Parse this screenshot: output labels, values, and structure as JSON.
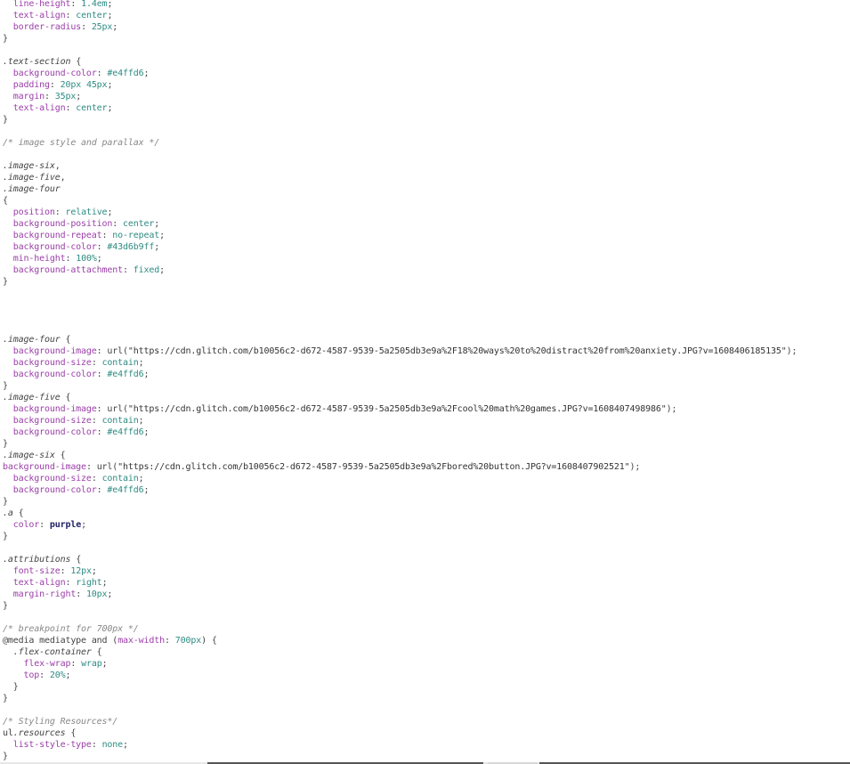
{
  "editor": {
    "language": "css",
    "lines": [
      {
        "t": [
          [
            "prop",
            "  line-height"
          ],
          [
            "punct",
            ": "
          ],
          [
            "num",
            "1.4em"
          ],
          [
            "punct",
            ";"
          ]
        ]
      },
      {
        "t": [
          [
            "prop",
            "  text-align"
          ],
          [
            "punct",
            ": "
          ],
          [
            "val",
            "center"
          ],
          [
            "punct",
            ";"
          ]
        ]
      },
      {
        "t": [
          [
            "prop",
            "  border-radius"
          ],
          [
            "punct",
            ": "
          ],
          [
            "num",
            "25px"
          ],
          [
            "punct",
            ";"
          ]
        ]
      },
      {
        "t": [
          [
            "punct",
            "}"
          ]
        ]
      },
      {
        "t": []
      },
      {
        "t": [
          [
            "selector",
            ".text-section"
          ],
          [
            "punct",
            " {"
          ]
        ]
      },
      {
        "t": [
          [
            "prop",
            "  background-color"
          ],
          [
            "punct",
            ": "
          ],
          [
            "color",
            "#e4ffd6"
          ],
          [
            "punct",
            ";"
          ]
        ]
      },
      {
        "t": [
          [
            "prop",
            "  padding"
          ],
          [
            "punct",
            ": "
          ],
          [
            "num",
            "20px 45px"
          ],
          [
            "punct",
            ";"
          ]
        ]
      },
      {
        "t": [
          [
            "prop",
            "  margin"
          ],
          [
            "punct",
            ": "
          ],
          [
            "num",
            "35px"
          ],
          [
            "punct",
            ";"
          ]
        ]
      },
      {
        "t": [
          [
            "prop",
            "  text-align"
          ],
          [
            "punct",
            ": "
          ],
          [
            "val",
            "center"
          ],
          [
            "punct",
            ";"
          ]
        ]
      },
      {
        "t": [
          [
            "punct",
            "}"
          ]
        ]
      },
      {
        "t": []
      },
      {
        "t": [
          [
            "comment",
            "/* image style and parallax */"
          ]
        ]
      },
      {
        "t": []
      },
      {
        "t": [
          [
            "selector",
            ".image-six"
          ],
          [
            "punct",
            ","
          ]
        ]
      },
      {
        "t": [
          [
            "selector",
            ".image-five"
          ],
          [
            "punct",
            ","
          ]
        ]
      },
      {
        "t": [
          [
            "selector",
            ".image-four"
          ]
        ]
      },
      {
        "t": [
          [
            "punct",
            "{"
          ]
        ]
      },
      {
        "t": [
          [
            "prop",
            "  position"
          ],
          [
            "punct",
            ": "
          ],
          [
            "val",
            "relative"
          ],
          [
            "punct",
            ";"
          ]
        ]
      },
      {
        "t": [
          [
            "prop",
            "  background-position"
          ],
          [
            "punct",
            ": "
          ],
          [
            "val",
            "center"
          ],
          [
            "punct",
            ";"
          ]
        ]
      },
      {
        "t": [
          [
            "prop",
            "  background-repeat"
          ],
          [
            "punct",
            ": "
          ],
          [
            "val",
            "no-repeat"
          ],
          [
            "punct",
            ";"
          ]
        ]
      },
      {
        "t": [
          [
            "prop",
            "  background-color"
          ],
          [
            "punct",
            ": "
          ],
          [
            "color",
            "#43d6b9ff"
          ],
          [
            "punct",
            ";"
          ]
        ]
      },
      {
        "t": [
          [
            "prop",
            "  min-height"
          ],
          [
            "punct",
            ": "
          ],
          [
            "num",
            "100%"
          ],
          [
            "punct",
            ";"
          ]
        ]
      },
      {
        "t": [
          [
            "prop",
            "  background-attachment"
          ],
          [
            "punct",
            ": "
          ],
          [
            "val",
            "fixed"
          ],
          [
            "punct",
            ";"
          ]
        ]
      },
      {
        "t": [
          [
            "punct",
            "}"
          ]
        ]
      },
      {
        "t": []
      },
      {
        "t": []
      },
      {
        "t": []
      },
      {
        "t": []
      },
      {
        "t": [
          [
            "selector",
            ".image-four"
          ],
          [
            "punct",
            " {"
          ]
        ]
      },
      {
        "t": [
          [
            "prop",
            "  background-image"
          ],
          [
            "punct",
            ": "
          ],
          [
            "fn",
            "url("
          ],
          [
            "str",
            "\"https://cdn.glitch.com/b10056c2-d672-4587-9539-5a2505db3e9a%2F18%20ways%20to%20distract%20from%20anxiety.JPG?v=1608406185135\""
          ],
          [
            "fn",
            ")"
          ],
          [
            "punct",
            ";"
          ]
        ]
      },
      {
        "t": [
          [
            "prop",
            "  background-size"
          ],
          [
            "punct",
            ": "
          ],
          [
            "val",
            "contain"
          ],
          [
            "punct",
            ";"
          ]
        ]
      },
      {
        "t": [
          [
            "prop",
            "  background-color"
          ],
          [
            "punct",
            ": "
          ],
          [
            "color",
            "#e4ffd6"
          ],
          [
            "punct",
            ";"
          ]
        ]
      },
      {
        "t": [
          [
            "punct",
            "}"
          ]
        ]
      },
      {
        "t": [
          [
            "selector",
            ".image-five"
          ],
          [
            "punct",
            " {"
          ]
        ]
      },
      {
        "t": [
          [
            "prop",
            "  background-image"
          ],
          [
            "punct",
            ": "
          ],
          [
            "fn",
            "url("
          ],
          [
            "str",
            "\"https://cdn.glitch.com/b10056c2-d672-4587-9539-5a2505db3e9a%2Fcool%20math%20games.JPG?v=1608407498986\""
          ],
          [
            "fn",
            ")"
          ],
          [
            "punct",
            ";"
          ]
        ]
      },
      {
        "t": [
          [
            "prop",
            "  background-size"
          ],
          [
            "punct",
            ": "
          ],
          [
            "val",
            "contain"
          ],
          [
            "punct",
            ";"
          ]
        ]
      },
      {
        "t": [
          [
            "prop",
            "  background-color"
          ],
          [
            "punct",
            ": "
          ],
          [
            "color",
            "#e4ffd6"
          ],
          [
            "punct",
            ";"
          ]
        ]
      },
      {
        "t": [
          [
            "punct",
            "}"
          ]
        ]
      },
      {
        "t": [
          [
            "selector",
            ".image-six"
          ],
          [
            "punct",
            " {"
          ]
        ]
      },
      {
        "t": [
          [
            "prop",
            "background-image"
          ],
          [
            "punct",
            ": "
          ],
          [
            "fn",
            "url("
          ],
          [
            "str",
            "\"https://cdn.glitch.com/b10056c2-d672-4587-9539-5a2505db3e9a%2Fbored%20button.JPG?v=1608407902521\""
          ],
          [
            "fn",
            ")"
          ],
          [
            "punct",
            ";"
          ]
        ]
      },
      {
        "t": [
          [
            "prop",
            "  background-size"
          ],
          [
            "punct",
            ": "
          ],
          [
            "val",
            "contain"
          ],
          [
            "punct",
            ";"
          ]
        ]
      },
      {
        "t": [
          [
            "prop",
            "  background-color"
          ],
          [
            "punct",
            ": "
          ],
          [
            "color",
            "#e4ffd6"
          ],
          [
            "punct",
            ";"
          ]
        ]
      },
      {
        "t": [
          [
            "punct",
            "}"
          ]
        ]
      },
      {
        "t": [
          [
            "selector",
            ".a"
          ],
          [
            "punct",
            " {"
          ]
        ]
      },
      {
        "t": [
          [
            "prop",
            "  color"
          ],
          [
            "punct",
            ": "
          ],
          [
            "purple",
            "purple"
          ],
          [
            "punct",
            ";"
          ]
        ]
      },
      {
        "t": [
          [
            "punct",
            "}"
          ]
        ]
      },
      {
        "t": []
      },
      {
        "t": [
          [
            "selector",
            ".attributions"
          ],
          [
            "punct",
            " {"
          ]
        ]
      },
      {
        "t": [
          [
            "prop",
            "  font-size"
          ],
          [
            "punct",
            ": "
          ],
          [
            "num",
            "12px"
          ],
          [
            "punct",
            ";"
          ]
        ]
      },
      {
        "t": [
          [
            "prop",
            "  text-align"
          ],
          [
            "punct",
            ": "
          ],
          [
            "val",
            "right"
          ],
          [
            "punct",
            ";"
          ]
        ]
      },
      {
        "t": [
          [
            "prop",
            "  margin-right"
          ],
          [
            "punct",
            ": "
          ],
          [
            "num",
            "10px"
          ],
          [
            "punct",
            ";"
          ]
        ]
      },
      {
        "t": [
          [
            "punct",
            "}"
          ]
        ]
      },
      {
        "t": []
      },
      {
        "t": [
          [
            "comment",
            "/* breakpoint for 700px */"
          ]
        ]
      },
      {
        "t": [
          [
            "keyword",
            "@media mediatype "
          ],
          [
            "keyword",
            "and"
          ],
          [
            "punct",
            " ("
          ],
          [
            "prop",
            "max-width"
          ],
          [
            "punct",
            ": "
          ],
          [
            "num",
            "700px"
          ],
          [
            "punct",
            ") {"
          ]
        ]
      },
      {
        "t": [
          [
            "selector",
            "  .flex-container"
          ],
          [
            "punct",
            " {"
          ]
        ]
      },
      {
        "t": [
          [
            "prop",
            "    flex-wrap"
          ],
          [
            "punct",
            ": "
          ],
          [
            "val",
            "wrap"
          ],
          [
            "punct",
            ";"
          ]
        ]
      },
      {
        "t": [
          [
            "prop",
            "    top"
          ],
          [
            "punct",
            ": "
          ],
          [
            "num",
            "20%"
          ],
          [
            "punct",
            ";"
          ]
        ]
      },
      {
        "t": [
          [
            "punct",
            "  }"
          ]
        ]
      },
      {
        "t": [
          [
            "punct",
            "}"
          ]
        ]
      },
      {
        "t": []
      },
      {
        "t": [
          [
            "comment",
            "/* Styling Resources*/"
          ]
        ]
      },
      {
        "t": [
          [
            "tag",
            "ul"
          ],
          [
            "selector",
            ".resources"
          ],
          [
            "punct",
            " {"
          ]
        ]
      },
      {
        "t": [
          [
            "prop",
            "  list-style-type"
          ],
          [
            "punct",
            ": "
          ],
          [
            "val",
            "none"
          ],
          [
            "punct",
            ";"
          ]
        ]
      },
      {
        "t": [
          [
            "punct",
            "}"
          ]
        ]
      }
    ]
  }
}
